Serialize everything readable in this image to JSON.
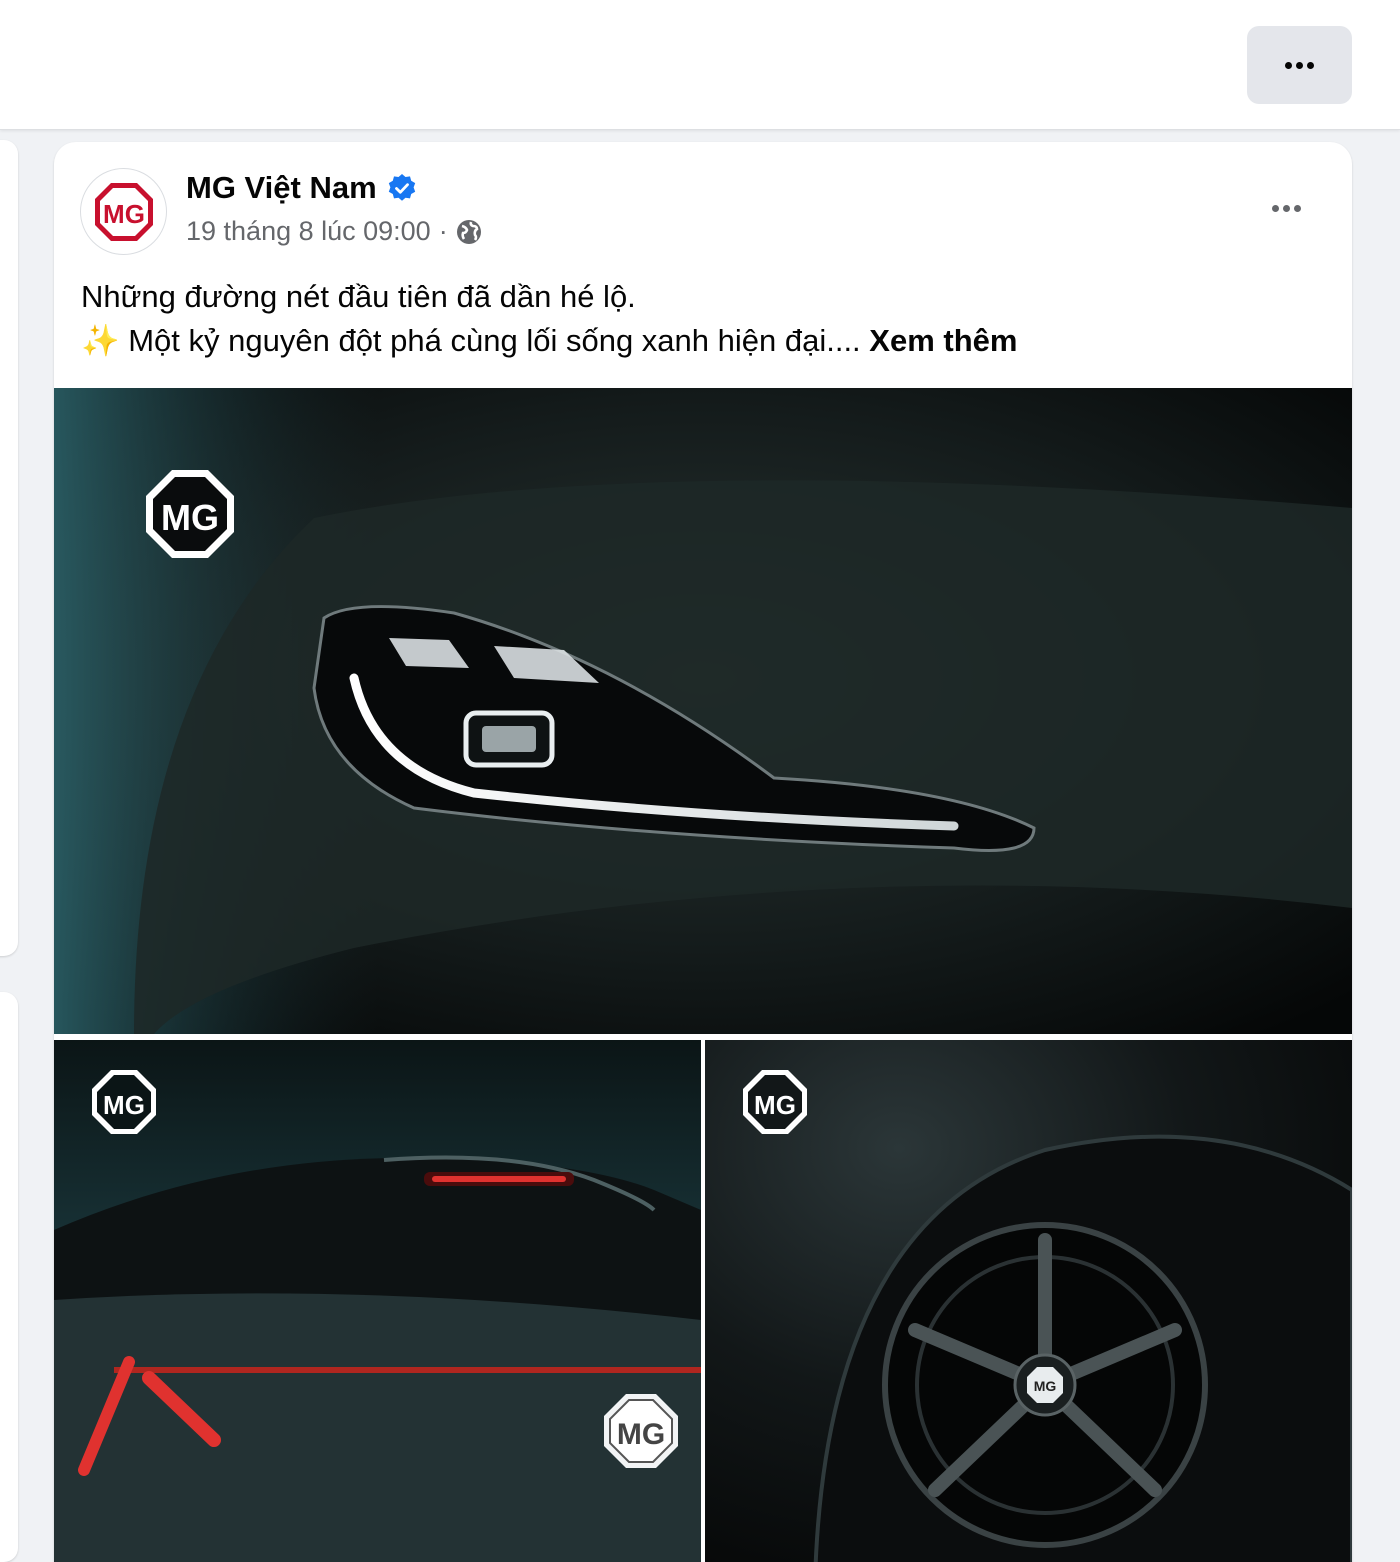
{
  "topbar": {
    "more_icon": "more-horizontal-icon"
  },
  "post": {
    "author": "MG Việt Nam",
    "verified_icon": "verified-badge-icon",
    "timestamp": "19 tháng 8 lúc 09:00",
    "separator": "·",
    "audience_icon": "globe-icon",
    "more_icon": "more-horizontal-icon",
    "text_line_1": "Những đường nét đầu tiên đã dần hé lộ.",
    "text_line_2_emoji": "✨",
    "text_line_2": "Một kỷ nguyên đột phá cùng lối sống xanh hiện đại....",
    "see_more": "Xem thêm",
    "avatar_logo_text": "MG",
    "photos": [
      {
        "subject": "headlight",
        "logo_text": "MG"
      },
      {
        "subject": "taillight",
        "logo_text": "MG",
        "badge_text": "MG"
      },
      {
        "subject": "wheel",
        "logo_text": "MG",
        "hub_text": "MG"
      }
    ]
  },
  "colors": {
    "brand_red": "#c8102e",
    "verified_blue": "#1877f2",
    "secondary_text": "#65676b"
  }
}
